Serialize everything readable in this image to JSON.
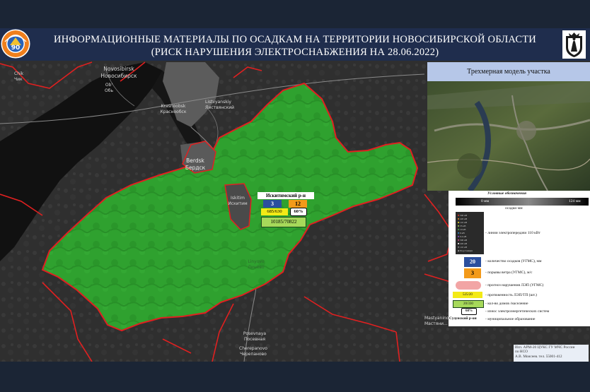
{
  "header": {
    "title_line1": "ИНФОРМАЦИОННЫЕ МАТЕРИАЛЫ ПО ОСАДКАМ НА ТЕРРИТОРИИ НОВОСИБИРСКОЙ ОБЛАСТИ",
    "title_line2": "(РИСК НАРУШЕНИЯ ЭЛЕКТРОСНАБЖЕНИЯ НА 28.06.2022)"
  },
  "inset": {
    "title": "Трехмерная модель участка"
  },
  "map": {
    "places": [
      {
        "name": "Novosibirsk",
        "name_ru": "Новосибирск"
      },
      {
        "name": "Ob'",
        "name_ru": "Обь"
      },
      {
        "name": "Iskitim",
        "name_ru": "Искитим"
      },
      {
        "name": "Krasnoobsk",
        "name_ru": "Краснообск"
      },
      {
        "name": "Berdsk",
        "name_ru": "Бердск"
      },
      {
        "name": "Linyovo",
        "name_ru": "Линёво"
      },
      {
        "name": "Posevnaya",
        "name_ru": "Посевная"
      },
      {
        "name": "Cherepanovo",
        "name_ru": "Черепаново"
      },
      {
        "name": "Mastyanino",
        "name_ru": "Мастяни..."
      },
      {
        "name": "Chik",
        "name_ru": "Чик"
      },
      {
        "name": "Tolmachevo",
        "name_ru": "Толмачево"
      },
      {
        "name": "Listvyanskiy",
        "name_ru": "Листвянский"
      }
    ],
    "region_color": "#2fa12f",
    "border_color": "#e02020"
  },
  "popup": {
    "district": "Искитимский р-н",
    "precip": "3",
    "wind": "12",
    "lines": "685/630",
    "percent": "60%",
    "houses": "10185/70822"
  },
  "legend": {
    "title": "Условные обозначения",
    "scale_min": "0 мм",
    "scale_max": "124 мм",
    "scale_caption": "осадки мм",
    "kv_items": [
      "500 кВ",
      "220 кВ",
      "110 кВ",
      "35 кВ",
      "10 кВ",
      "6 кВ",
      "0.4 кВ",
      "500 кВ",
      "220 кВ",
      "110 кВ",
      "Подстанции"
    ],
    "kv_caption": "- линии электропередачи 110 кВт",
    "precip_value": "20",
    "precip_caption": "- количество осадков (УГМС), мм",
    "wind_value": "3",
    "wind_caption": "- порывы ветра (УГМС), м/с",
    "forecast_caption": "- прогноз нарушения ЛЭП (УГМС)",
    "lines_value": "525/20",
    "lines_caption": "- протяженность ЛЭП/ТП (шт.)",
    "houses_value": "20/330",
    "houses_caption": "- кол-во домов /население",
    "percent_value": "60%",
    "percent_caption": "- износ электроэнергетических систем",
    "district_value": "Сузунский р-он",
    "district_caption": "- муниципальное образование"
  },
  "credit": {
    "line1": "Исп. АРМ-20 ЦУКС ГУ МЧС России",
    "line2": "по НСО",
    "line3": "А.В. Моисеев. тел. 55001-412"
  }
}
